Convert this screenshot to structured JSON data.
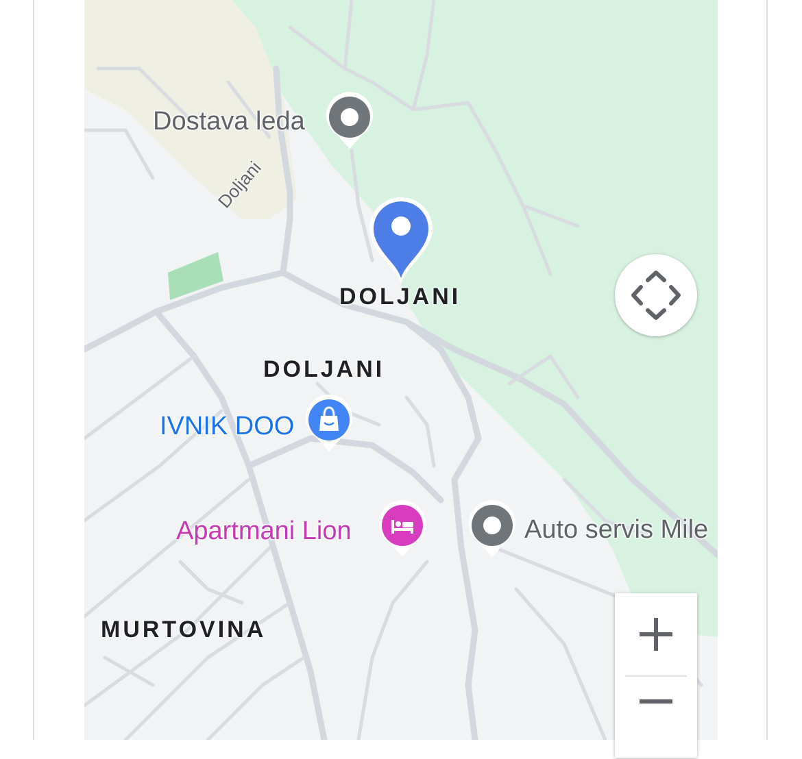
{
  "map": {
    "colors": {
      "background": "#f1f3f4",
      "park": "#d8f2e1",
      "field": "#efefe4",
      "park_accent": "#a8dfb7",
      "road": "#d3d8de"
    },
    "labels": {
      "road_doljani": "Doljani",
      "area_doljani_main": "DOLJANI",
      "area_doljani_second": "DOLJANI",
      "area_murtovina": "MURTOVINA"
    },
    "pois": [
      {
        "name": "Dostava leda",
        "category": "generic-place",
        "icon": "location-dot-icon",
        "color": "#70757a",
        "text_color": "#5f6368"
      },
      {
        "name": "IVNIK DOO",
        "category": "shopping",
        "icon": "shopping-bag-icon",
        "color": "#1a73e8",
        "text_color": "#1a73e8"
      },
      {
        "name": "Apartmani Lion",
        "category": "lodging",
        "icon": "bed-icon",
        "color": "#d93dbf",
        "text_color": "#c43ab5"
      },
      {
        "name": "Auto servis Mile",
        "category": "generic-place",
        "icon": "location-dot-icon",
        "color": "#70757a",
        "text_color": "#5f6368"
      }
    ],
    "selected_marker": {
      "icon": "location-pin-icon",
      "color": "#4d7ee8"
    },
    "controls": {
      "pan_icon": "move-arrows-icon",
      "zoom_in_icon": "plus-icon",
      "zoom_out_icon": "minus-icon"
    }
  }
}
